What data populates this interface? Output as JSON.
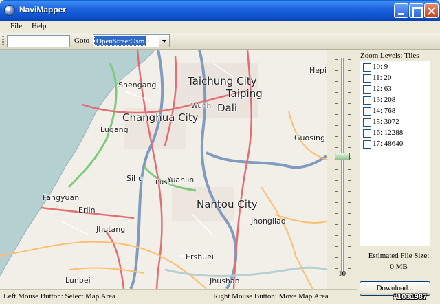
{
  "window": {
    "title": "NaviMapper"
  },
  "menu": {
    "items": [
      {
        "label": "File"
      },
      {
        "label": "Help"
      }
    ]
  },
  "toolbar": {
    "search_value": "",
    "goto_label": "Goto",
    "goto_selected": "OpenStreetOsm"
  },
  "map": {
    "places": [
      {
        "name": "Taichung City"
      },
      {
        "name": "Taiping"
      },
      {
        "name": "Dali"
      },
      {
        "name": "Wurih"
      },
      {
        "name": "Shengang"
      },
      {
        "name": "Changhua City"
      },
      {
        "name": "Lugang"
      },
      {
        "name": "Sihu"
      },
      {
        "name": "Pusin"
      },
      {
        "name": "Yuanlin"
      },
      {
        "name": "Nantou City"
      },
      {
        "name": "Fangyuan"
      },
      {
        "name": "Erlin"
      },
      {
        "name": "Jhutang"
      },
      {
        "name": "Jhongliao"
      },
      {
        "name": "Guosing"
      },
      {
        "name": "Hepi"
      },
      {
        "name": "Ershuei"
      },
      {
        "name": "Jhushan"
      },
      {
        "name": "Lunbei"
      }
    ]
  },
  "slider": {
    "value_label": "10",
    "level": 10,
    "min": 10,
    "max": 17
  },
  "zoom_panel": {
    "header": "Zoom Levels: Tiles",
    "levels": [
      {
        "label": "10: 9",
        "checked": false
      },
      {
        "label": "11: 20",
        "checked": false
      },
      {
        "label": "12: 63",
        "checked": false
      },
      {
        "label": "13: 208",
        "checked": false
      },
      {
        "label": "14: 768",
        "checked": false
      },
      {
        "label": "15: 3072",
        "checked": false
      },
      {
        "label": "16: 12288",
        "checked": false
      },
      {
        "label": "17: 48640",
        "checked": false
      }
    ],
    "estimated_label": "Estimated File Size:",
    "estimated_value": "0 MB",
    "download_label": "Download..."
  },
  "status": {
    "left": "Left Mouse Button: Select Map Area",
    "right": "Right Mouse Button: Move Map Area"
  },
  "watermark": "#1031987",
  "colors": {
    "title_bar": "#0a4cc8",
    "sea": "#b5d0d0",
    "land": "#f2efe9",
    "motorway": "#809bc0",
    "trunk": "#7fc97f",
    "primary": "#e46d71",
    "secondary": "#fdbf6f"
  }
}
